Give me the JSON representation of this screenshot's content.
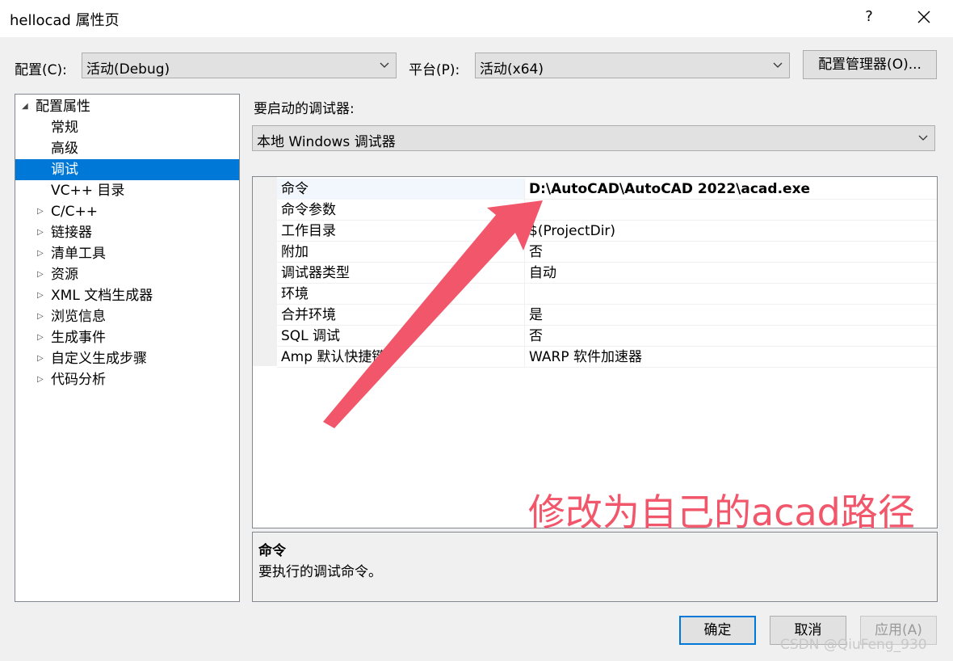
{
  "window": {
    "title": "hellocad 属性页",
    "help_label": "?"
  },
  "config": {
    "label": "配置(C):",
    "value": "活动(Debug)",
    "platform_label": "平台(P):",
    "platform_value": "活动(x64)",
    "manager_button": "配置管理器(O)..."
  },
  "tree": {
    "items": [
      {
        "label": "配置属性",
        "expander": "◢"
      },
      {
        "label": "常规"
      },
      {
        "label": "高级"
      },
      {
        "label": "调试",
        "selected": true
      },
      {
        "label": "VC++ 目录"
      },
      {
        "label": "C/C++",
        "expander": "▷"
      },
      {
        "label": "链接器",
        "expander": "▷"
      },
      {
        "label": "清单工具",
        "expander": "▷"
      },
      {
        "label": "资源",
        "expander": "▷"
      },
      {
        "label": "XML 文档生成器",
        "expander": "▷"
      },
      {
        "label": "浏览信息",
        "expander": "▷"
      },
      {
        "label": "生成事件",
        "expander": "▷"
      },
      {
        "label": "自定义生成步骤",
        "expander": "▷"
      },
      {
        "label": "代码分析",
        "expander": "▷"
      }
    ]
  },
  "debugger": {
    "label": "要启动的调试器:",
    "value": "本地 Windows 调试器"
  },
  "properties": [
    {
      "name": "命令",
      "value": "D:\\AutoCAD\\AutoCAD 2022\\acad.exe",
      "selected": true,
      "bold": true
    },
    {
      "name": "命令参数",
      "value": ""
    },
    {
      "name": "工作目录",
      "value": "$(ProjectDir)"
    },
    {
      "name": "附加",
      "value": "否"
    },
    {
      "name": "调试器类型",
      "value": "自动"
    },
    {
      "name": "环境",
      "value": ""
    },
    {
      "name": "合并环境",
      "value": "是"
    },
    {
      "name": "SQL 调试",
      "value": "否"
    },
    {
      "name": "Amp 默认快捷键",
      "value": "WARP 软件加速器"
    }
  ],
  "description": {
    "title": "命令",
    "text": "要执行的调试命令。"
  },
  "annotation": {
    "text": "修改为自己的acad路径",
    "color": "#f2566a"
  },
  "buttons": {
    "ok": "确定",
    "cancel": "取消",
    "apply": "应用(A)"
  },
  "watermark": "CSDN @QiuFeng_930",
  "colors": {
    "accent": "#0078d7",
    "background": "#f0f0f0"
  }
}
